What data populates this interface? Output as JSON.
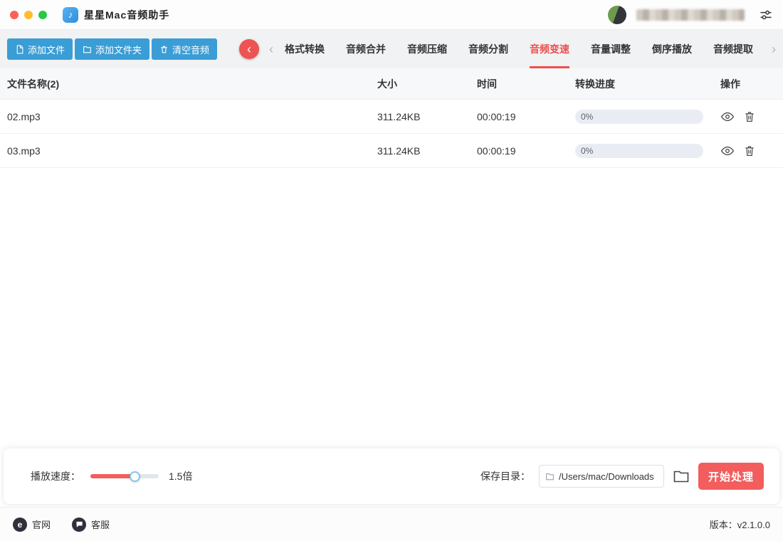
{
  "titlebar": {
    "app_title": "星星Mac音频助手"
  },
  "toolbar": {
    "add_file_label": "添加文件",
    "add_folder_label": "添加文件夹",
    "clear_audio_label": "清空音频"
  },
  "tabs": [
    {
      "label": "格式转换"
    },
    {
      "label": "音频合并"
    },
    {
      "label": "音频压缩"
    },
    {
      "label": "音频分割"
    },
    {
      "label": "音频变速"
    },
    {
      "label": "音量调整"
    },
    {
      "label": "倒序播放"
    },
    {
      "label": "音频提取"
    }
  ],
  "active_tab": "音频变速",
  "table": {
    "headers": {
      "name": "文件名称(2)",
      "size": "大小",
      "time": "时间",
      "progress": "转换进度",
      "actions": "操作"
    },
    "rows": [
      {
        "name": "02.mp3",
        "size": "311.24KB",
        "time": "00:00:19",
        "progress_text": "0%",
        "progress_value": 0
      },
      {
        "name": "03.mp3",
        "size": "311.24KB",
        "time": "00:00:19",
        "progress_text": "0%",
        "progress_value": 0
      }
    ]
  },
  "controls": {
    "speed_label": "播放速度：",
    "speed_value": "1.5倍",
    "save_dir_label": "保存目录：",
    "save_dir_path": "/Users/mac/Downloads",
    "start_button_label": "开始处理"
  },
  "footer": {
    "official_site_label": "官网",
    "support_label": "客服",
    "version_label": "版本：v2.1.0.0"
  },
  "icons": {
    "note_glyph": "♪",
    "back_chevron": "‹",
    "chevron_left": "‹",
    "chevron_right": "›",
    "globe_glyph": "e"
  },
  "colors": {
    "accent_red": "#f25d5d",
    "tab_active_red": "#ee4f4f",
    "accent_blue": "#3b9dd6"
  }
}
